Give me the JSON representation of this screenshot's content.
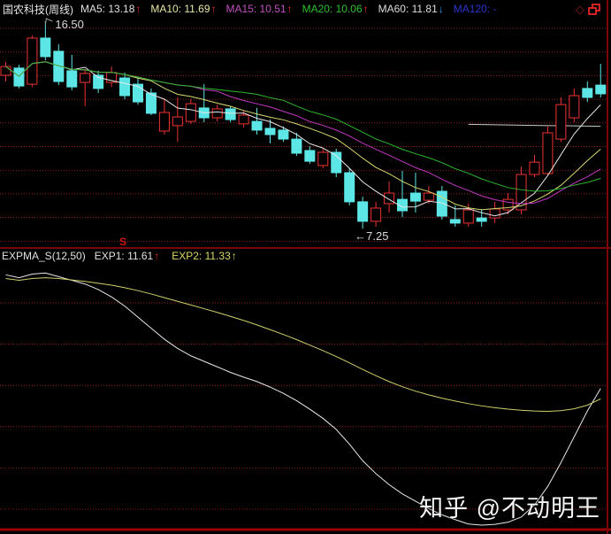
{
  "header": {
    "title": "国农科技(周线)",
    "indicators": [
      {
        "label": "MA5:",
        "value": "13.18",
        "color": "#e0e0e0",
        "arrow": "↑",
        "arrow_color": "#f03030"
      },
      {
        "label": "MA10:",
        "value": "11.69",
        "color": "#e6e6a8",
        "arrow": "↑",
        "arrow_color": "#f03030"
      },
      {
        "label": "MA15:",
        "value": "10.51",
        "color": "#c050c0",
        "arrow": "↑",
        "arrow_color": "#f03030"
      },
      {
        "label": "MA20:",
        "value": "10.06",
        "color": "#2fbf2f",
        "arrow": "↑",
        "arrow_color": "#f03030"
      },
      {
        "label": "MA60:",
        "value": "11.81",
        "color": "#dcdcdc",
        "arrow": "↓",
        "arrow_color": "#2e9bff"
      },
      {
        "label": "MA120:",
        "value": "-",
        "color": "#2a35cd",
        "arrow": "",
        "arrow_color": "#2a35cd"
      }
    ],
    "icons": {
      "diamond": "◇"
    }
  },
  "sub_header": {
    "name": "EXPMA_S(12,50)",
    "exp1_label": "EXP1:",
    "exp1_value": "11.61",
    "exp1_arrow": "↑",
    "exp2_label": "EXP2:",
    "exp2_value": "11.33",
    "exp2_arrow": "↑"
  },
  "annotations": {
    "high_label": "16.50",
    "low_label": "←7.25",
    "signal_label": "S",
    "signal_index": 9
  },
  "watermark": {
    "text": "知乎 @不动明王"
  },
  "colors": {
    "background": "#000000",
    "grid": "#8e2020",
    "divider": "#7a0606",
    "bottom_line": "#990000",
    "candle_up": "#ee3232",
    "candle_down": "#5ce6e6",
    "label_text": "#d8d8d8",
    "signal": "#cc1414"
  },
  "chart_data": [
    {
      "type": "candlestick",
      "title": "国农科技 weekly price",
      "ylim": [
        7.25,
        16.5
      ],
      "grid": true,
      "ohlc": [
        [
          14.09,
          14.68,
          13.81,
          14.48
        ],
        [
          14.41,
          14.56,
          13.5,
          13.61
        ],
        [
          13.69,
          15.87,
          13.57,
          15.75
        ],
        [
          15.75,
          16.5,
          14.76,
          14.92
        ],
        [
          15.16,
          15.47,
          13.65,
          13.81
        ],
        [
          14.29,
          15.0,
          13.42,
          13.57
        ],
        [
          13.77,
          14.37,
          12.71,
          14.17
        ],
        [
          14.09,
          14.29,
          13.3,
          13.5
        ],
        [
          13.77,
          14.48,
          13.57,
          14.21
        ],
        [
          13.97,
          14.21,
          13.02,
          13.18
        ],
        [
          13.69,
          13.97,
          12.78,
          12.9
        ],
        [
          13.3,
          13.5,
          12.31,
          12.39
        ],
        [
          11.6,
          13.02,
          11.44,
          12.43
        ],
        [
          11.84,
          13.1,
          11.12,
          12.23
        ],
        [
          12.03,
          13.02,
          11.92,
          12.82
        ],
        [
          12.63,
          13.69,
          11.99,
          12.19
        ],
        [
          12.19,
          12.78,
          12.03,
          12.59
        ],
        [
          12.59,
          12.71,
          11.99,
          12.11
        ],
        [
          11.92,
          12.51,
          11.76,
          12.31
        ],
        [
          12.03,
          12.63,
          11.44,
          11.64
        ],
        [
          11.72,
          12.11,
          11.05,
          11.44
        ],
        [
          11.64,
          11.8,
          11.12,
          11.24
        ],
        [
          11.24,
          11.52,
          10.49,
          10.61
        ],
        [
          10.73,
          10.93,
          10.14,
          10.25
        ],
        [
          10.06,
          10.81,
          9.94,
          10.65
        ],
        [
          10.65,
          10.81,
          9.54,
          9.74
        ],
        [
          9.74,
          9.94,
          8.28,
          8.44
        ],
        [
          8.44,
          8.67,
          7.25,
          7.57
        ],
        [
          7.57,
          8.44,
          7.33,
          8.16
        ],
        [
          8.36,
          9.35,
          7.96,
          8.83
        ],
        [
          8.55,
          9.82,
          7.76,
          8.04
        ],
        [
          8.83,
          9.74,
          7.96,
          8.47
        ],
        [
          8.51,
          9.15,
          8.36,
          8.83
        ],
        [
          8.91,
          9.15,
          7.65,
          7.8
        ],
        [
          7.65,
          8.28,
          7.33,
          7.49
        ],
        [
          7.49,
          8.36,
          7.33,
          8.08
        ],
        [
          7.72,
          8.12,
          7.33,
          7.57
        ],
        [
          7.72,
          8.44,
          7.49,
          8.12
        ],
        [
          8.08,
          8.83,
          7.88,
          8.55
        ],
        [
          8.08,
          10.02,
          7.88,
          9.66
        ],
        [
          9.66,
          10.53,
          9.54,
          10.21
        ],
        [
          9.7,
          11.8,
          9.62,
          11.52
        ],
        [
          11.24,
          13.1,
          11.12,
          12.78
        ],
        [
          12.19,
          13.5,
          11.99,
          13.18
        ],
        [
          13.5,
          13.81,
          12.9,
          13.1
        ],
        [
          13.65,
          14.6,
          13.1,
          13.26
        ]
      ],
      "ma_overlays": [
        {
          "name": "MA5",
          "period": 5,
          "color": "#e8e8e8"
        },
        {
          "name": "MA10",
          "period": 10,
          "color": "#d8d870"
        },
        {
          "name": "MA15",
          "period": 15,
          "color": "#c238c2"
        },
        {
          "name": "MA20",
          "period": 20,
          "color": "#2eb82e"
        }
      ],
      "ma60_segment": {
        "name": "MA60",
        "color": "#c8c8c8",
        "start_index": 35,
        "values": [
          11.9,
          11.89,
          11.88,
          11.87,
          11.86,
          11.85,
          11.84,
          11.84,
          11.83,
          11.82,
          11.81
        ]
      },
      "high_annotation": {
        "index": 3,
        "price": 16.5,
        "label": "16.50"
      },
      "low_annotation": {
        "index": 27,
        "price": 7.25,
        "label": "←7.25"
      }
    },
    {
      "type": "line",
      "title": "EXPMA_S(12,50)",
      "ylim": [
        7.9,
        14.9
      ],
      "series": [
        {
          "name": "EXP1",
          "color": "#e8e8e8",
          "values": [
            14.7,
            14.62,
            14.72,
            14.75,
            14.65,
            14.55,
            14.45,
            14.3,
            14.1,
            13.85,
            13.55,
            13.25,
            12.95,
            12.7,
            12.5,
            12.35,
            12.2,
            12.05,
            11.92,
            11.8,
            11.65,
            11.48,
            11.28,
            11.05,
            10.8,
            10.5,
            10.1,
            9.65,
            9.3,
            9.0,
            8.75,
            8.55,
            8.35,
            8.18,
            8.05,
            7.93,
            7.9,
            7.92,
            7.98,
            8.12,
            8.45,
            8.95,
            9.6,
            10.3,
            11.0,
            11.61
          ]
        },
        {
          "name": "EXP2",
          "color": "#cfcf6a",
          "values": [
            14.6,
            14.55,
            14.6,
            14.62,
            14.6,
            14.56,
            14.52,
            14.47,
            14.42,
            14.35,
            14.27,
            14.18,
            14.08,
            13.98,
            13.88,
            13.78,
            13.68,
            13.57,
            13.46,
            13.34,
            13.21,
            13.08,
            12.94,
            12.79,
            12.64,
            12.48,
            12.31,
            12.13,
            11.96,
            11.8,
            11.66,
            11.54,
            11.44,
            11.35,
            11.27,
            11.2,
            11.14,
            11.09,
            11.05,
            11.02,
            11.0,
            10.99,
            11.01,
            11.06,
            11.16,
            11.33
          ]
        }
      ]
    }
  ]
}
